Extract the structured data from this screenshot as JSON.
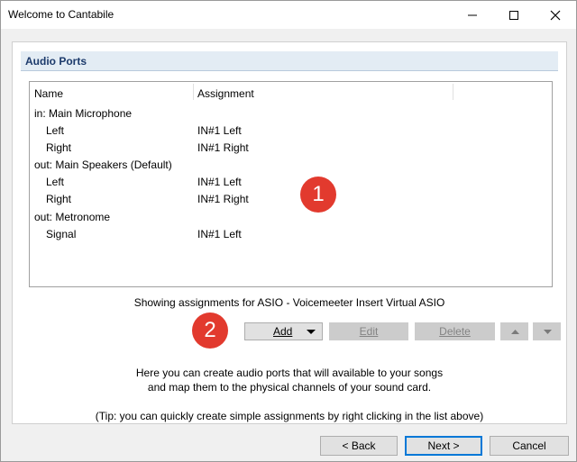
{
  "window": {
    "title": "Welcome to Cantabile"
  },
  "section": {
    "title": "Audio Ports"
  },
  "list": {
    "columns": [
      "Name",
      "Assignment"
    ],
    "rows": [
      {
        "name": "in: Main Microphone",
        "assignment": ""
      },
      {
        "name": "Left",
        "assignment": "IN#1 Left"
      },
      {
        "name": "Right",
        "assignment": "IN#1 Right"
      },
      {
        "name": "out: Main Speakers (Default)",
        "assignment": ""
      },
      {
        "name": "Left",
        "assignment": "IN#1 Left"
      },
      {
        "name": "Right",
        "assignment": "IN#1 Right"
      },
      {
        "name": "out: Metronome",
        "assignment": ""
      },
      {
        "name": "Signal",
        "assignment": "IN#1 Left"
      }
    ]
  },
  "status_text": "Showing assignments for ASIO - Voicemeeter Insert Virtual ASIO",
  "buttons": {
    "add": "Add",
    "edit": "Edit",
    "delete": "Delete"
  },
  "markers": {
    "one": "1",
    "two": "2"
  },
  "help": {
    "line1": "Here you can create audio ports that will available to your songs",
    "line2": "and map them to the physical channels of your sound card.",
    "tip": "(Tip: you can quickly create simple assignments by right clicking in the list above)"
  },
  "footer": {
    "back": "< Back",
    "next": "Next >",
    "cancel": "Cancel"
  },
  "colors": {
    "header_bg": "#e3ecf4",
    "header_text": "#1c3a6b",
    "marker": "#e23a2e",
    "default_border": "#0078d7"
  }
}
